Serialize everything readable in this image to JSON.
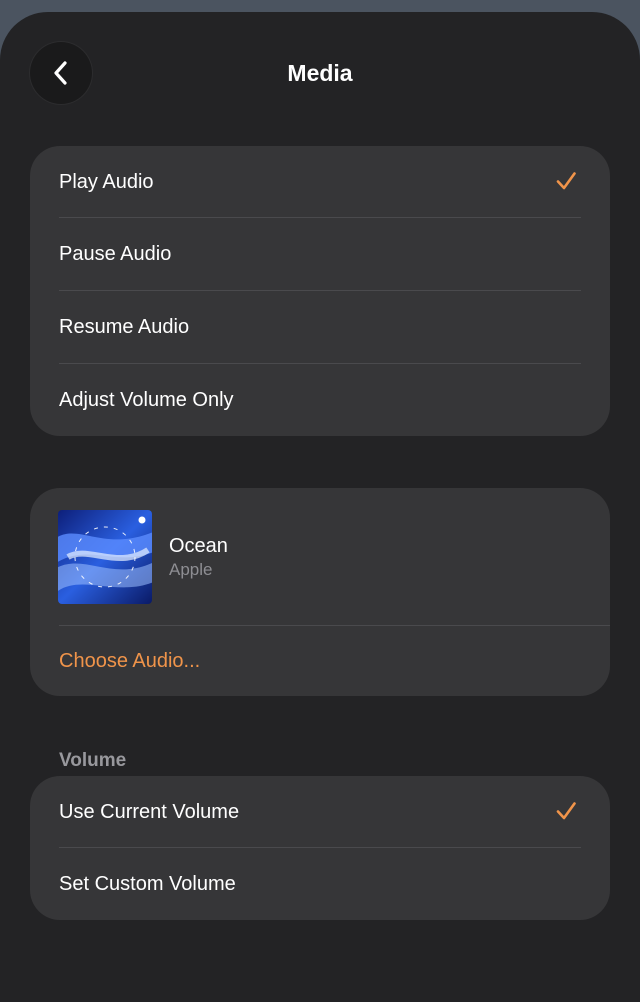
{
  "header": {
    "title": "Media",
    "back_icon": "chevron-left-icon"
  },
  "action_options": {
    "items": [
      {
        "label": "Play Audio",
        "selected": true
      },
      {
        "label": "Pause Audio",
        "selected": false
      },
      {
        "label": "Resume Audio",
        "selected": false
      },
      {
        "label": "Adjust Volume Only",
        "selected": false
      }
    ]
  },
  "audio": {
    "title": "Ocean",
    "artist": "Apple",
    "artwork_icon": "album-artwork",
    "choose_label": "Choose Audio..."
  },
  "volume": {
    "section_label": "Volume",
    "items": [
      {
        "label": "Use Current Volume",
        "selected": true
      },
      {
        "label": "Set Custom Volume",
        "selected": false
      }
    ]
  },
  "colors": {
    "background": "#232325",
    "card": "#363638",
    "accent": "#f0944a",
    "secondary_text": "#8e8e93"
  }
}
